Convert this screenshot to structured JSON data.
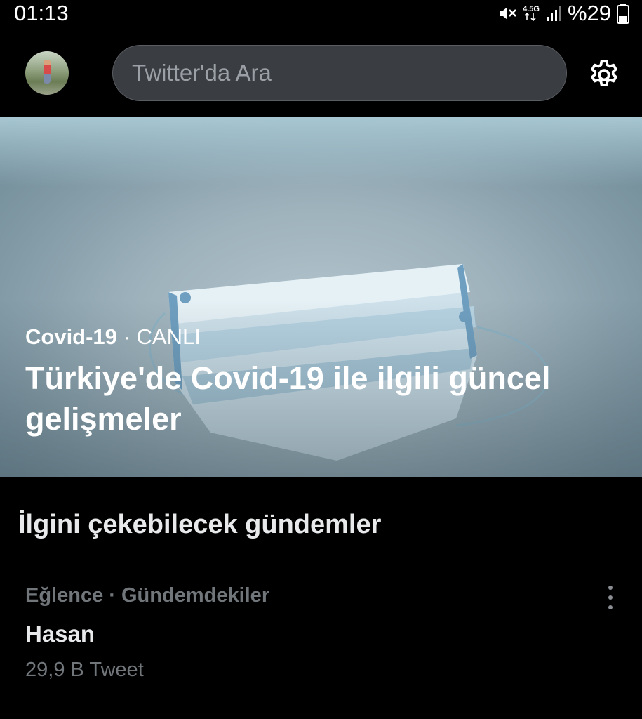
{
  "status_bar": {
    "time": "01:13",
    "network": "4.5G",
    "battery": "%29"
  },
  "header": {
    "search_placeholder": "Twitter'da Ara",
    "avatar_icon": "avatar-photo",
    "settings_icon": "gear-icon"
  },
  "hero": {
    "category": "Covid-19",
    "separator": "·",
    "live_label": "CANLI",
    "title": "Türkiye'de Covid-19 ile ilgili güncel gelişmeler"
  },
  "section": {
    "title": "İlgini çekebilecek gündemler"
  },
  "trends": [
    {
      "meta": "Eğlence · Gündemdekiler",
      "name": "Hasan",
      "count": "29,9 B Tweet"
    }
  ],
  "colors": {
    "background": "#000000",
    "search_bg": "#3a3d42",
    "secondary_text": "#71767b",
    "primary_text": "#e7e9ea"
  }
}
